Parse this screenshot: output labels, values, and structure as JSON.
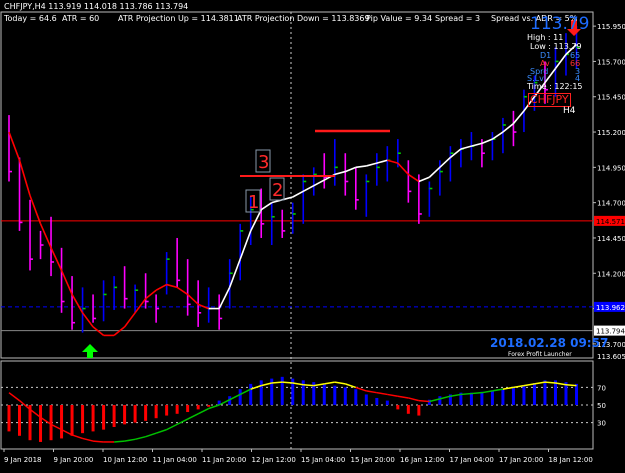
{
  "header": {
    "symbol_line": "CHFJPY,H4  113.919 114.018 113.786 113.794",
    "today": "Today = 64.6",
    "atr": "ATR = 60",
    "atr_up": "ATR Projection Up = 114.3811",
    "atr_down": "ATR Projection Down = 113.8369",
    "pip_value": "Pip Value = 9.34",
    "spread": "Spread = 3",
    "spread_vs_adr": "Spread vs. ADR = 5%"
  },
  "info_panel": {
    "big_price": "113.79",
    "high": "High : 11",
    "low": "Low : 113.79",
    "d1_label": "D1",
    "d1_value": "65",
    "av_label": "Av",
    "av_value": "66",
    "sprd_label": "Sprd",
    "sprd_value": "3",
    "slvl_label": "S.Lvl",
    "slvl_value": "4",
    "time": "Time : 122:15",
    "symbol": "CHFJPY",
    "timeframe": "H4"
  },
  "watermark": {
    "datetime": "2018.02.28 09:57",
    "brand": "Forex Profit Launcher"
  },
  "markers": [
    "1",
    "2",
    "3"
  ],
  "price_axis": {
    "labels": [
      "115.950",
      "115.700",
      "115.450",
      "115.200",
      "114.950",
      "114.700",
      "114.450",
      "114.200",
      "113.950",
      "113.700"
    ],
    "red_line_label": "114.571",
    "blue_line_label": "113.962",
    "current_label": "113.794",
    "bottom_label": "113.605"
  },
  "indicator_axis": {
    "labels": [
      "70",
      "50",
      "30"
    ]
  },
  "time_axis": {
    "labels": [
      "9 Jan 2018",
      "9 Jan 20:00",
      "10 Jan 12:00",
      "11 Jan 04:00",
      "11 Jan 20:00",
      "12 Jan 12:00",
      "15 Jan 04:00",
      "15 Jan 20:00",
      "16 Jan 12:00",
      "17 Jan 04:00",
      "17 Jan 20:00",
      "18 Jan 12:00"
    ]
  },
  "colors": {
    "bull": "#0000ff",
    "bear": "#ff00ff",
    "ma_up": "#ffffff",
    "ma_down": "#ff0000",
    "accent_green": "#00ff00",
    "level_red": "#ff0000",
    "level_blue": "#0000ff",
    "info_blue": "#1e6cff"
  },
  "chart_data": {
    "type": "candlestick",
    "symbol": "CHFJPY",
    "timeframe": "H4",
    "ylim": [
      113.6,
      116.05
    ],
    "levels": {
      "red": 114.571,
      "blue": 113.962,
      "current": 113.794
    },
    "candles": [
      {
        "h": 115.32,
        "l": 114.85,
        "c": 114.92,
        "bull": false
      },
      {
        "h": 115.02,
        "l": 114.5,
        "c": 114.56,
        "bull": false
      },
      {
        "h": 114.72,
        "l": 114.22,
        "c": 114.3,
        "bull": false
      },
      {
        "h": 114.5,
        "l": 114.3,
        "c": 114.4,
        "bull": false
      },
      {
        "h": 114.6,
        "l": 114.18,
        "c": 114.28,
        "bull": false
      },
      {
        "h": 114.38,
        "l": 113.92,
        "c": 114.0,
        "bull": false
      },
      {
        "h": 114.18,
        "l": 113.8,
        "c": 113.85,
        "bull": false
      },
      {
        "h": 114.1,
        "l": 113.78,
        "c": 113.95,
        "bull": true
      },
      {
        "h": 114.05,
        "l": 113.85,
        "c": 113.88,
        "bull": false
      },
      {
        "h": 114.15,
        "l": 113.86,
        "c": 114.05,
        "bull": true
      },
      {
        "h": 114.18,
        "l": 113.94,
        "c": 114.1,
        "bull": true
      },
      {
        "h": 114.25,
        "l": 113.95,
        "c": 114.02,
        "bull": false
      },
      {
        "h": 114.12,
        "l": 113.92,
        "c": 114.08,
        "bull": true
      },
      {
        "h": 114.2,
        "l": 113.95,
        "c": 114.0,
        "bull": false
      },
      {
        "h": 114.05,
        "l": 113.85,
        "c": 113.95,
        "bull": false
      },
      {
        "h": 114.35,
        "l": 114.05,
        "c": 114.3,
        "bull": true
      },
      {
        "h": 114.45,
        "l": 114.1,
        "c": 114.15,
        "bull": false
      },
      {
        "h": 114.3,
        "l": 113.9,
        "c": 113.98,
        "bull": false
      },
      {
        "h": 114.15,
        "l": 113.82,
        "c": 113.92,
        "bull": false
      },
      {
        "h": 114.1,
        "l": 113.85,
        "c": 113.95,
        "bull": true
      },
      {
        "h": 114.05,
        "l": 113.8,
        "c": 113.88,
        "bull": false
      },
      {
        "h": 114.3,
        "l": 113.95,
        "c": 114.2,
        "bull": true
      },
      {
        "h": 114.55,
        "l": 114.15,
        "c": 114.5,
        "bull": true
      },
      {
        "h": 114.75,
        "l": 114.4,
        "c": 114.65,
        "bull": true
      },
      {
        "h": 114.8,
        "l": 114.45,
        "c": 114.55,
        "bull": false
      },
      {
        "h": 114.7,
        "l": 114.4,
        "c": 114.6,
        "bull": true
      },
      {
        "h": 114.65,
        "l": 114.45,
        "c": 114.5,
        "bull": false
      },
      {
        "h": 114.7,
        "l": 114.48,
        "c": 114.62,
        "bull": true
      },
      {
        "h": 114.9,
        "l": 114.55,
        "c": 114.85,
        "bull": true
      },
      {
        "h": 114.95,
        "l": 114.75,
        "c": 114.9,
        "bull": true
      },
      {
        "h": 115.05,
        "l": 114.8,
        "c": 114.88,
        "bull": false
      },
      {
        "h": 115.15,
        "l": 114.82,
        "c": 114.95,
        "bull": true
      },
      {
        "h": 115.05,
        "l": 114.75,
        "c": 114.85,
        "bull": false
      },
      {
        "h": 114.95,
        "l": 114.65,
        "c": 114.72,
        "bull": false
      },
      {
        "h": 114.9,
        "l": 114.6,
        "c": 114.85,
        "bull": true
      },
      {
        "h": 115.05,
        "l": 114.82,
        "c": 114.95,
        "bull": true
      },
      {
        "h": 115.1,
        "l": 114.85,
        "c": 115.0,
        "bull": true
      },
      {
        "h": 115.15,
        "l": 114.95,
        "c": 115.05,
        "bull": true
      },
      {
        "h": 115.0,
        "l": 114.7,
        "c": 114.78,
        "bull": false
      },
      {
        "h": 114.9,
        "l": 114.55,
        "c": 114.62,
        "bull": false
      },
      {
        "h": 114.85,
        "l": 114.6,
        "c": 114.8,
        "bull": true
      },
      {
        "h": 115.0,
        "l": 114.75,
        "c": 114.92,
        "bull": true
      },
      {
        "h": 115.1,
        "l": 114.85,
        "c": 115.05,
        "bull": true
      },
      {
        "h": 115.15,
        "l": 114.95,
        "c": 115.08,
        "bull": true
      },
      {
        "h": 115.2,
        "l": 115.0,
        "c": 115.1,
        "bull": true
      },
      {
        "h": 115.15,
        "l": 114.95,
        "c": 115.05,
        "bull": false
      },
      {
        "h": 115.2,
        "l": 115.0,
        "c": 115.15,
        "bull": true
      },
      {
        "h": 115.3,
        "l": 115.05,
        "c": 115.25,
        "bull": true
      },
      {
        "h": 115.35,
        "l": 115.1,
        "c": 115.2,
        "bull": false
      },
      {
        "h": 115.5,
        "l": 115.2,
        "c": 115.45,
        "bull": true
      },
      {
        "h": 115.6,
        "l": 115.35,
        "c": 115.55,
        "bull": true
      },
      {
        "h": 115.7,
        "l": 115.4,
        "c": 115.5,
        "bull": false
      },
      {
        "h": 115.8,
        "l": 115.45,
        "c": 115.7,
        "bull": true
      },
      {
        "h": 115.9,
        "l": 115.6,
        "c": 115.75,
        "bull": true
      },
      {
        "h": 115.95,
        "l": 115.65,
        "c": 115.8,
        "bull": true
      }
    ],
    "ma": [
      115.2,
      115.0,
      114.75,
      114.55,
      114.38,
      114.22,
      114.05,
      113.92,
      113.82,
      113.76,
      113.76,
      113.82,
      113.92,
      114.02,
      114.08,
      114.12,
      114.1,
      114.05,
      113.98,
      113.95,
      113.95,
      114.1,
      114.3,
      114.5,
      114.65,
      114.7,
      114.72,
      114.74,
      114.78,
      114.82,
      114.86,
      114.9,
      114.92,
      114.95,
      114.96,
      114.98,
      115.0,
      114.98,
      114.9,
      114.85,
      114.88,
      114.95,
      115.02,
      115.08,
      115.1,
      115.12,
      115.15,
      115.2,
      115.26,
      115.35,
      115.45,
      115.55,
      115.65,
      115.75,
      115.82
    ],
    "ma_trend": [
      "dn",
      "dn",
      "dn",
      "dn",
      "dn",
      "dn",
      "dn",
      "dn",
      "dn",
      "dn",
      "dn",
      "dn",
      "dn",
      "dn",
      "dn",
      "dn",
      "dn",
      "dn",
      "dn",
      "dn",
      "up",
      "up",
      "up",
      "up",
      "up",
      "up",
      "up",
      "up",
      "up",
      "up",
      "up",
      "up",
      "up",
      "up",
      "up",
      "up",
      "up",
      "dn",
      "dn",
      "dn",
      "up",
      "up",
      "up",
      "up",
      "up",
      "up",
      "up",
      "up",
      "up",
      "up",
      "up",
      "up",
      "up",
      "up",
      "up"
    ],
    "indicator": {
      "ylim": [
        0,
        100
      ],
      "levels": [
        70,
        50,
        30
      ],
      "line": [
        64,
        55,
        45,
        36,
        28,
        22,
        16,
        12,
        9,
        8,
        8,
        9,
        11,
        14,
        18,
        22,
        28,
        34,
        40,
        46,
        50,
        56,
        62,
        68,
        72,
        75,
        76,
        75,
        73,
        72,
        74,
        76,
        74,
        70,
        66,
        64,
        62,
        60,
        58,
        55,
        54,
        57,
        60,
        62,
        63,
        64,
        66,
        68,
        70,
        72,
        74,
        76,
        75,
        73,
        72
      ],
      "bars": [
        -30,
        -35,
        -40,
        -42,
        -40,
        -38,
        -35,
        -32,
        -30,
        -28,
        -25,
        -22,
        -20,
        -18,
        -15,
        -12,
        -10,
        -8,
        -5,
        -2,
        5,
        10,
        18,
        24,
        28,
        30,
        32,
        30,
        28,
        26,
        24,
        22,
        20,
        18,
        12,
        8,
        5,
        -5,
        -10,
        -12,
        6,
        10,
        12,
        14,
        14,
        15,
        16,
        18,
        20,
        22,
        25,
        28,
        28,
        26,
        24
      ]
    }
  }
}
